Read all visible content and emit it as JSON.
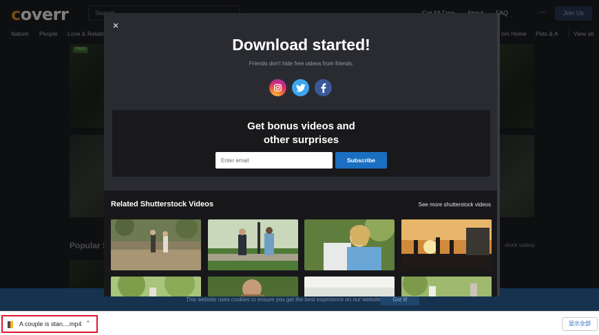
{
  "site": {
    "logo_letter": "c",
    "logo_rest": "overr",
    "search_placeholder": "Search",
    "nav_items": [
      "Get All Free",
      "About",
      "FAQ"
    ],
    "more_glyph": "···",
    "join_label": "Join Us",
    "categories": [
      "Nature",
      "People",
      "Love & Relatio"
    ],
    "categories_right": [
      "om Home",
      "Pets & A",
      "View all"
    ],
    "free_badge": "FREE",
    "popular_heading": "Popular S",
    "popular_link": "stock videos"
  },
  "cookie": {
    "text": "This website uses cookies to ensure you get the best experience on our website",
    "button": "Got it!"
  },
  "modal": {
    "close_glyph": "×",
    "title": "Download started!",
    "subtitle": "Friends don't hide free videos from friends.",
    "bonus_line1": "Get bonus videos and",
    "bonus_line2": "other surprises",
    "email_placeholder": "Enter email",
    "subscribe_label": "Subscribe",
    "related_title": "Related Shutterstock Videos",
    "related_link": "See more shutterstock videos"
  },
  "download_shelf": {
    "file_name": "A couple is stan....mp4",
    "caret": "^",
    "show_all": "显示全部"
  },
  "colors": {
    "accent_blue": "#1a6fc0",
    "highlight_red": "#e0152b",
    "instagram": "#d62976",
    "twitter": "#3ea6ee",
    "facebook": "#3b5998"
  }
}
